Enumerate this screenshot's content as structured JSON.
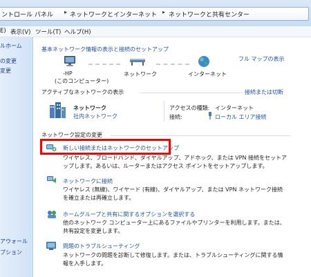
{
  "breadcrumb": {
    "items": [
      "ントロール パネル",
      "ネットワークとインターネット",
      "ネットワークと共有センター"
    ]
  },
  "menu": {
    "items": [
      "E)",
      "表示(V)",
      "ツール(T)",
      "ヘルプ(H)"
    ]
  },
  "left_pane": {
    "items": [
      "ルホーム",
      "の変更",
      "変更"
    ],
    "bottom_items": [
      "アウォール",
      "プション"
    ]
  },
  "main": {
    "header": "基本ネットワーク情報の表示と接続のセットアップ",
    "full_map_link": "フル マップの表示",
    "nodes": [
      {
        "label": "-HP",
        "sublabel": "(このコンピューター)",
        "icon": "computer-icon"
      },
      {
        "label": "ネットワーク",
        "icon": "network-bench-icon"
      },
      {
        "label": "インターネット",
        "icon": "globe-icon"
      }
    ],
    "active_title": "アクティブなネットワークの表示",
    "connect_link": "接続または切断",
    "network": {
      "name": "ネットワーク",
      "type": "社内ネットワーク",
      "access_label": "アクセスの種類:",
      "access_value": "インターネット",
      "connection_label": "接続:",
      "connection_value": "ローカル エリア接続"
    },
    "change_title": "ネットワーク設定の変更",
    "tasks": [
      {
        "title": "新しい接続またはネットワークのセットアップ",
        "desc": "ワイヤレス、ブロードバンド、ダイヤルアップ、アドホック、または VPN 接続をセットアップします。あるいは、ルーターまたはアクセス ポイントをセットアップします。",
        "icon": "new-connection-icon"
      },
      {
        "title": "ネットワークに接続",
        "desc": "ワイヤレス (無線)、ワイヤード (有線)、ダイヤルアップ、または VPN ネットワーク接続を確立または再確立します。",
        "icon": "connect-network-icon"
      },
      {
        "title": "ホームグループと共有に関するオプションを選択する",
        "desc": "他のネットワーク コンピューター上にあるファイルやプリンターを利用します。または、共有設定を変更します。",
        "icon": "homegroup-icon"
      },
      {
        "title": "問題のトラブルシューティング",
        "desc": "ネットワークの問題を診断して修復します。または、トラブルシューティングに関する情報を入手します。",
        "icon": "troubleshoot-icon"
      }
    ]
  },
  "colors": {
    "link": "#1f4fa8",
    "highlight": "#ff0000",
    "left_pane": "#d7e6f8"
  }
}
